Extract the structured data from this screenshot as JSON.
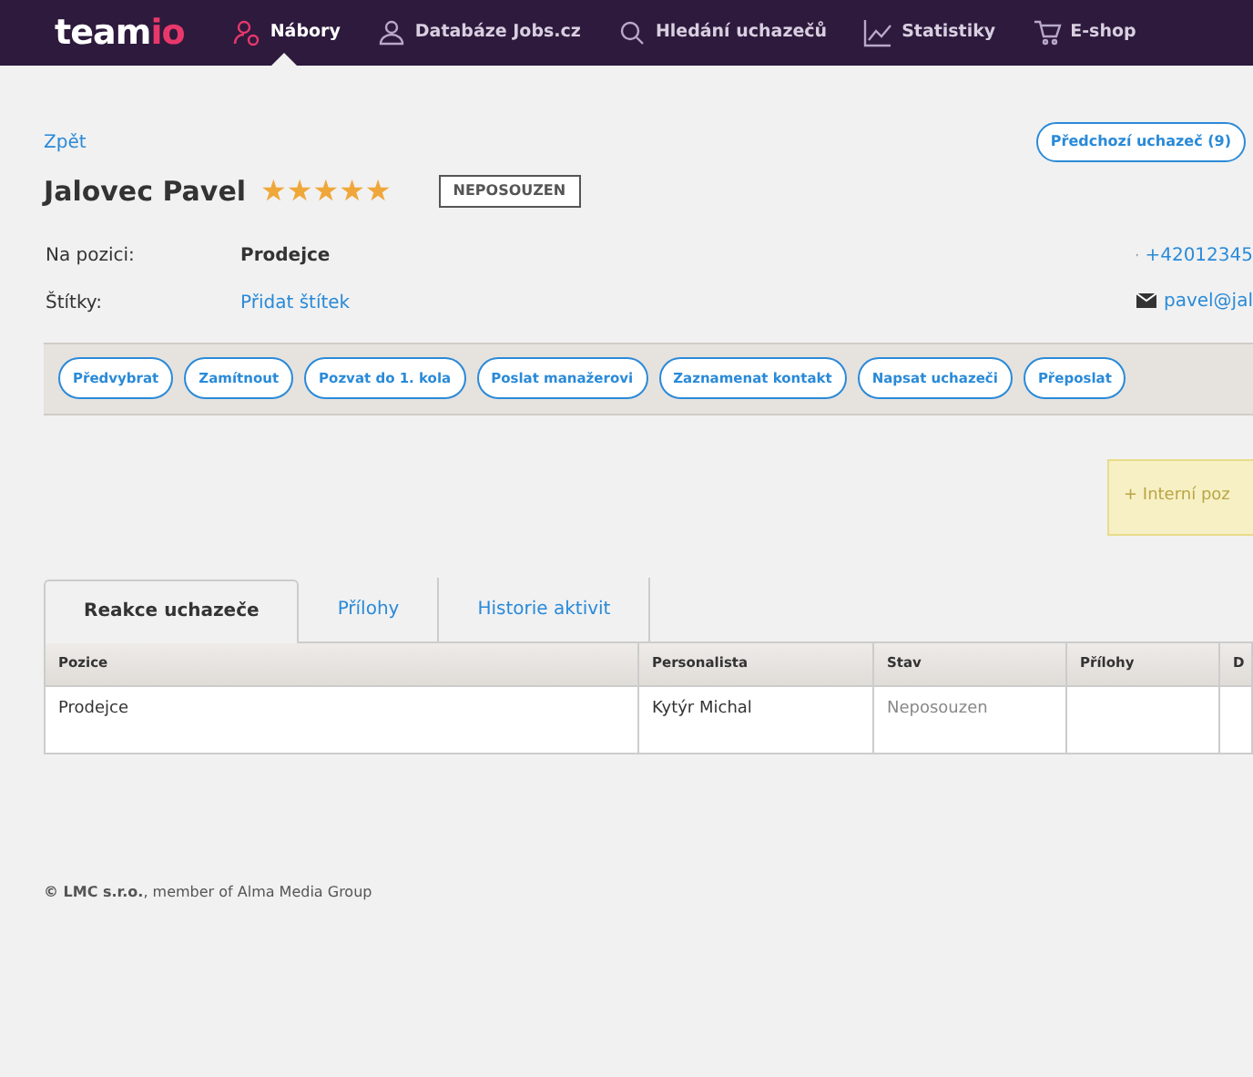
{
  "nav": {
    "logo": {
      "main": "team",
      "accent": "io"
    },
    "items": [
      {
        "label": "Nábory",
        "selected": true,
        "kind": "person"
      },
      {
        "label": "Databáze Jobs.cz",
        "selected": false,
        "kind": "people"
      },
      {
        "label": "Hledání uchazečů",
        "selected": false,
        "kind": "search"
      },
      {
        "label": "Statistiky",
        "selected": false,
        "kind": "chart"
      },
      {
        "label": "E-shop",
        "selected": false,
        "kind": "cart"
      }
    ]
  },
  "back_link": "Zpět",
  "previous_button": "Předchozí uchazeč (9)",
  "candidate": {
    "name": "Jalovec Pavel",
    "stars": 5,
    "status": "NEPOSOUZEN"
  },
  "details": [
    {
      "label": "Na pozici:",
      "value": "Prodejce",
      "kind": "text"
    },
    {
      "label": "Štítky:",
      "value": "Přidat štítek",
      "kind": "link"
    }
  ],
  "contacts": [
    {
      "kind": "phone",
      "value": "+42012345"
    },
    {
      "kind": "email",
      "value": "pavel@jal"
    }
  ],
  "actions": [
    "Předvybrat",
    "Zamítnout",
    "Pozvat do 1. kola",
    "Poslat manažerovi",
    "Zaznamenat kontakt",
    "Napsat uchazeči",
    "Přeposlat"
  ],
  "internal_note": {
    "icon": "+",
    "label": "Interní poz"
  },
  "tabs": [
    {
      "label": "Reakce uchazeče",
      "selected": true
    },
    {
      "label": "Přílohy",
      "selected": false
    },
    {
      "label": "Historie aktivit",
      "selected": false
    }
  ],
  "table": {
    "columns": [
      "Pozice",
      "Personalista",
      "Stav",
      "Přílohy",
      "D"
    ],
    "rows": [
      [
        "Prodejce",
        "Kytýr Michal",
        "Neposouzen",
        "",
        ""
      ]
    ]
  },
  "footer": {
    "company": "© LMC s.r.o.",
    "rest": ", member of Alma Media Group"
  }
}
